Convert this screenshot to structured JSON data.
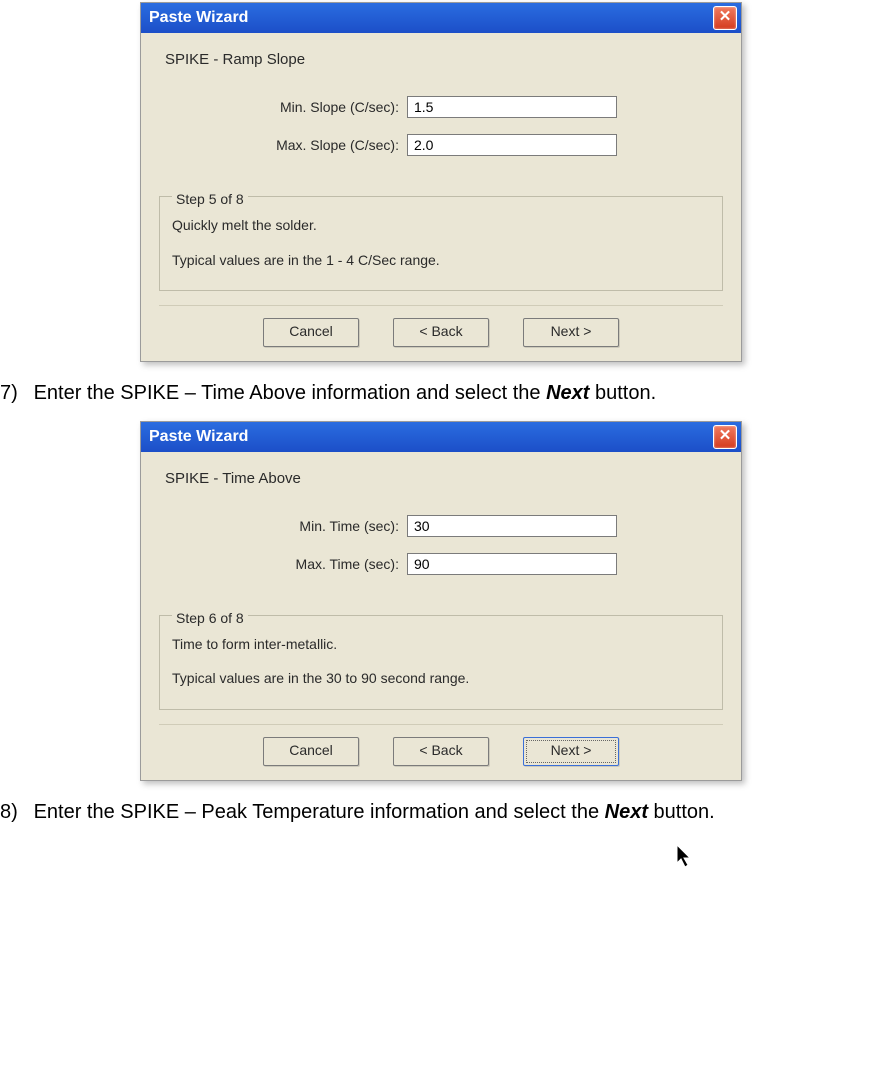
{
  "instructions": {
    "step7_num": "7)",
    "step7_a": "Enter the SPIKE – Time Above information and select the ",
    "step7_bold": "Next",
    "step7_b": " button.",
    "step8_num": "8)",
    "step8_a": "Enter the SPIKE – Peak Temperature information and select the ",
    "step8_bold": "Next",
    "step8_b": " button."
  },
  "dialog1": {
    "title": "Paste Wizard",
    "section": "SPIKE - Ramp Slope",
    "min_label": "Min. Slope (C/sec):",
    "min_value": "1.5",
    "max_label": "Max. Slope (C/sec):",
    "max_value": "2.0",
    "step": "Step 5 of 8",
    "desc1": "Quickly melt the solder.",
    "desc2": "Typical values are in the 1 - 4 C/Sec range.",
    "cancel": "Cancel",
    "back": "< Back",
    "next": "Next >"
  },
  "dialog2": {
    "title": "Paste Wizard",
    "section": "SPIKE - Time Above",
    "min_label": "Min. Time (sec):",
    "min_value": "30",
    "max_label": "Max. Time (sec):",
    "max_value": "90",
    "step": "Step 6 of 8",
    "desc1": "Time to form inter-metallic.",
    "desc2": "Typical values are in the 30 to 90 second range.",
    "cancel": "Cancel",
    "back": "< Back",
    "next": "Next >"
  }
}
